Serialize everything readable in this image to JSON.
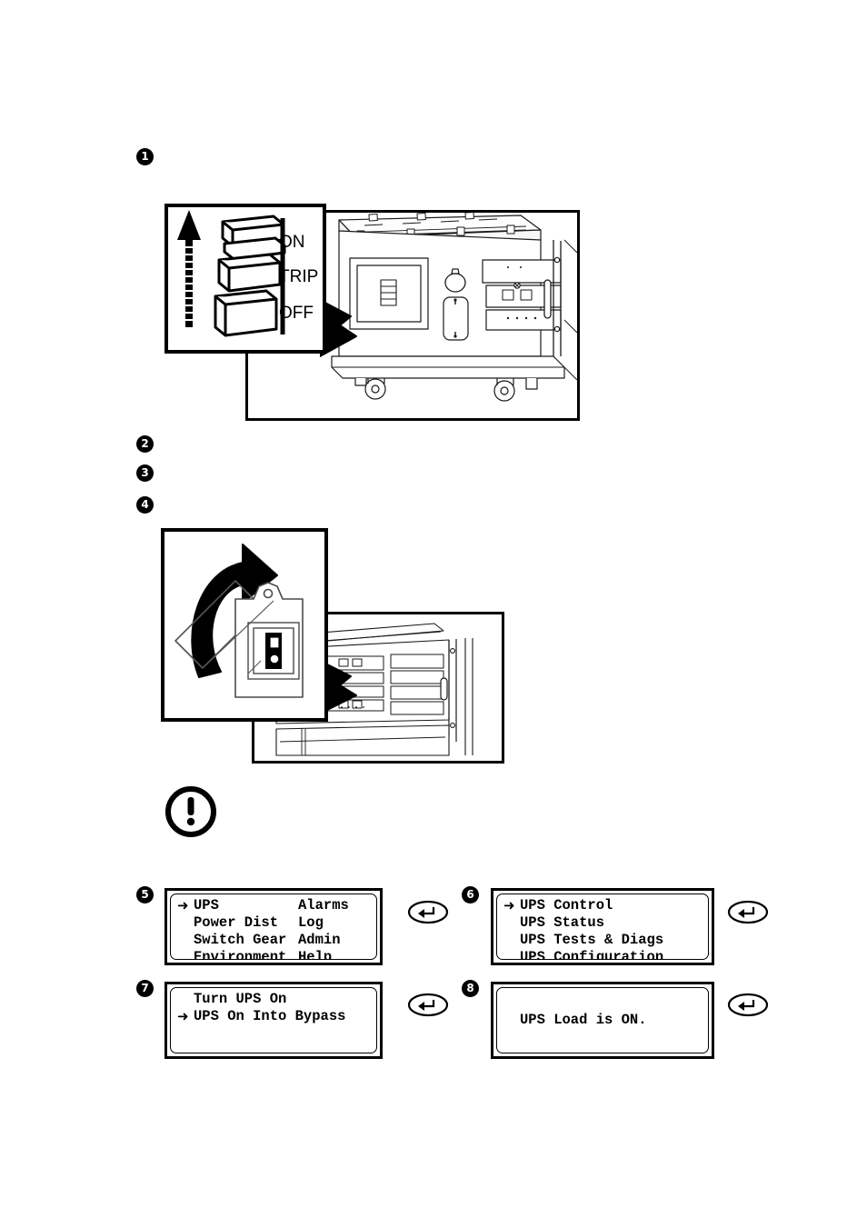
{
  "document": {
    "type": "ups-startup-procedure-illustration",
    "background_color": "#ffffff",
    "ink_color": "#000000"
  },
  "steps": [
    {
      "number": "1",
      "label_text": "1"
    },
    {
      "number": "2",
      "label_text": "2"
    },
    {
      "number": "3",
      "label_text": "3"
    },
    {
      "number": "4",
      "label_text": "4"
    },
    {
      "number": "5",
      "label_text": "5"
    },
    {
      "number": "6",
      "label_text": "6"
    },
    {
      "number": "7",
      "label_text": "7"
    },
    {
      "number": "8",
      "label_text": "8"
    }
  ],
  "figure_breaker": {
    "name": "ups-cabinet-breaker-callout",
    "legend": {
      "on": "ON",
      "trip": "TRIP",
      "off": "OFF"
    },
    "arrow_direction": "up"
  },
  "figure_keyswitch": {
    "name": "ups-cabinet-keyswitch-callout",
    "arrow_direction": "rotate-counterclockwise-up"
  },
  "warning": {
    "icon": "exclamation-circle-icon",
    "glyph": "!"
  },
  "lcd_panels": [
    {
      "step": "5",
      "name": "lcd-main-menu",
      "selector_line": 0,
      "selector_glyph": "➜",
      "lines": [
        {
          "col1": "UPS",
          "col2": "Alarms"
        },
        {
          "col1": "Power Dist",
          "col2": "Log"
        },
        {
          "col1": "Switch Gear",
          "col2": "Admin"
        },
        {
          "col1": "Environment",
          "col2": "Help"
        }
      ],
      "enter_key": {
        "name": "enter-key-icon",
        "glyph": "↵"
      }
    },
    {
      "step": "6",
      "name": "lcd-ups-menu",
      "selector_line": 0,
      "selector_glyph": "➜",
      "lines": [
        {
          "col1": "UPS Control",
          "col2": ""
        },
        {
          "col1": "UPS Status",
          "col2": ""
        },
        {
          "col1": "UPS Tests & Diags",
          "col2": ""
        },
        {
          "col1": "UPS Configuration",
          "col2": ""
        }
      ],
      "enter_key": {
        "name": "enter-key-icon",
        "glyph": "↵"
      }
    },
    {
      "step": "7",
      "name": "lcd-ups-control-menu",
      "selector_line": 1,
      "selector_glyph": "➜",
      "lines": [
        {
          "col1": "Turn UPS On",
          "col2": ""
        },
        {
          "col1": "UPS On Into Bypass",
          "col2": ""
        },
        {
          "col1": "",
          "col2": ""
        },
        {
          "col1": "",
          "col2": ""
        }
      ],
      "enter_key": {
        "name": "enter-key-icon",
        "glyph": "↵"
      }
    },
    {
      "step": "8",
      "name": "lcd-ups-load-status",
      "selector_line": -1,
      "selector_glyph": "",
      "lines": [
        {
          "col1": "",
          "col2": ""
        },
        {
          "col1": "UPS Load is ON.",
          "col2": ""
        },
        {
          "col1": "",
          "col2": ""
        },
        {
          "col1": "",
          "col2": ""
        }
      ],
      "enter_key": {
        "name": "enter-key-icon",
        "glyph": "↵"
      }
    }
  ]
}
